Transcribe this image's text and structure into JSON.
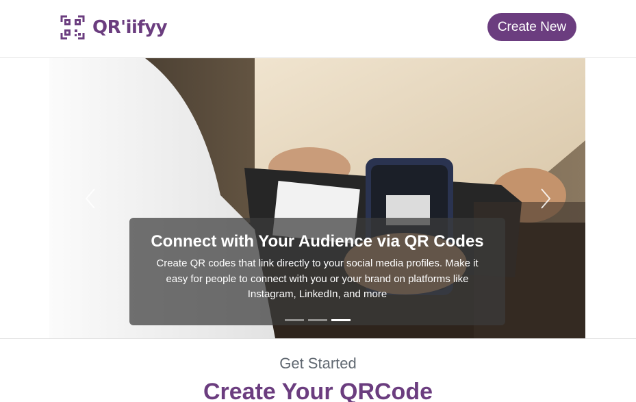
{
  "brand": {
    "name": "QR'iifyy",
    "logo_icon": "qr-code-icon",
    "accent_color": "#6b3d7f"
  },
  "header": {
    "create_button": "Create New"
  },
  "carousel": {
    "slide": {
      "title": "Connect with Your Audience via QR Codes",
      "text": "Create QR codes that link directly to your social media profiles. Make it easy for people to connect with you or your brand on platforms like Instagram, LinkedIn, and more"
    },
    "prev_icon": "chevron-left-icon",
    "next_icon": "chevron-right-icon",
    "slide_count": 3,
    "active_slide": 3
  },
  "section": {
    "subtitle": "Get Started",
    "title": "Create Your QRCode"
  }
}
